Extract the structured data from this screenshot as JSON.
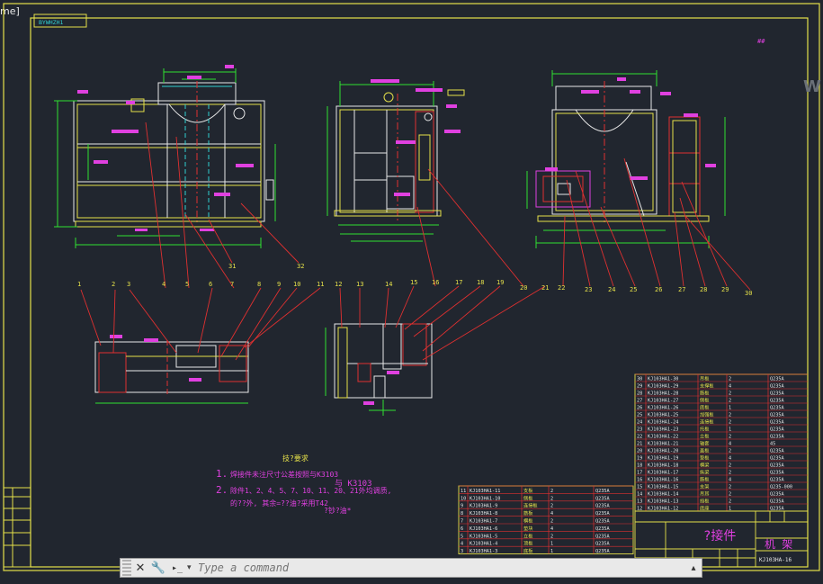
{
  "window": {
    "tab_label_fragment": "me]"
  },
  "watermark": "W",
  "drawing": {
    "title_block_stamp": "BYWHZH1",
    "top_right_note": "##",
    "callout_numbers": [
      "1",
      "2",
      "3",
      "4",
      "5",
      "6",
      "7",
      "8",
      "9",
      "10",
      "11",
      "12",
      "13",
      "14",
      "15",
      "16",
      "17",
      "18",
      "19",
      "20",
      "21",
      "22",
      "23",
      "24",
      "25",
      "26",
      "27",
      "28",
      "29",
      "30",
      "31",
      "32"
    ],
    "tech_requirements": {
      "heading": "技?要求",
      "line1_prefix": "1.",
      "line1_text": "焊接件未注尺寸公差按照与K3103",
      "line1_suffix": "与 K3103",
      "line2_prefix": "2.",
      "line2_text": "除件1、2、4、5、7、10、11、20、21外均调质,",
      "line3_text": "的??外, 其余=??油?采用T42",
      "line3_suffix": "?钞?油*"
    },
    "title_block": {
      "name_big": "?接件",
      "part_name": "机  架",
      "drawing_no": "KJ103HA-16"
    }
  },
  "parts_table_main": {
    "rows": [
      [
        "30",
        "KJ103HA1-30",
        "吊板",
        "2",
        "Q235A"
      ],
      [
        "29",
        "KJ103HA1-29",
        "支撑板",
        "4",
        "Q235A"
      ],
      [
        "28",
        "KJ103HA1-28",
        "筋板",
        "2",
        "Q235A"
      ],
      [
        "27",
        "KJ103HA1-27",
        "侧板",
        "2",
        "Q235A"
      ],
      [
        "26",
        "KJ103HA1-26",
        "底板",
        "1",
        "Q235A"
      ],
      [
        "25",
        "KJ103HA1-25",
        "加强板",
        "2",
        "Q235A"
      ],
      [
        "24",
        "KJ103HA1-24",
        "连接板",
        "2",
        "Q235A"
      ],
      [
        "23",
        "KJ103HA1-23",
        "托板",
        "1",
        "Q235A"
      ],
      [
        "22",
        "KJ103HA1-22",
        "立板",
        "2",
        "Q235A"
      ],
      [
        "21",
        "KJ103HA1-21",
        "轴套",
        "4",
        "45"
      ],
      [
        "20",
        "KJ103HA1-20",
        "盖板",
        "2",
        "Q235A"
      ],
      [
        "19",
        "KJ103HA1-19",
        "垫板",
        "4",
        "Q235A"
      ],
      [
        "18",
        "KJ103HA1-18",
        "横梁",
        "2",
        "Q235A"
      ],
      [
        "17",
        "KJ103HA1-17",
        "纵梁",
        "2",
        "Q235A"
      ],
      [
        "16",
        "KJ103HA1-16",
        "筋板",
        "4",
        "Q235A"
      ],
      [
        "15",
        "KJ103HA1-15",
        "支架",
        "2",
        "Q235-000"
      ],
      [
        "14",
        "KJ103HA1-14",
        "吊耳",
        "2",
        "Q235A"
      ],
      [
        "13",
        "KJ103HA1-13",
        "挡板",
        "2",
        "Q235A"
      ],
      [
        "12",
        "KJ103HA1-12",
        "底座",
        "1",
        "Q235A"
      ]
    ]
  },
  "parts_table_left": {
    "rows": [
      [
        "11",
        "KJ103HA1-11",
        "支板",
        "2",
        "Q235A"
      ],
      [
        "10",
        "KJ103HA1-10",
        "侧板",
        "2",
        "Q235A"
      ],
      [
        "9",
        "KJ103HA1-9",
        "连接板",
        "2",
        "Q235A"
      ],
      [
        "8",
        "KJ103HA1-8",
        "筋板",
        "4",
        "Q235A"
      ],
      [
        "7",
        "KJ103HA1-7",
        "横板",
        "2",
        "Q235A"
      ],
      [
        "6",
        "KJ103HA1-6",
        "垫块",
        "4",
        "Q235A"
      ],
      [
        "5",
        "KJ103HA1-5",
        "立板",
        "2",
        "Q235A"
      ],
      [
        "4",
        "KJ103HA1-4",
        "顶板",
        "1",
        "Q235A"
      ],
      [
        "3",
        "KJ103HA1-3",
        "底板",
        "1",
        "Q235A"
      ]
    ]
  },
  "command_line": {
    "placeholder": "Type a command",
    "close_glyph": "✕",
    "customize_glyph": "🔧",
    "prompt_glyph": "▸_",
    "caret_glyph": "▾",
    "up_glyph": "▴"
  }
}
